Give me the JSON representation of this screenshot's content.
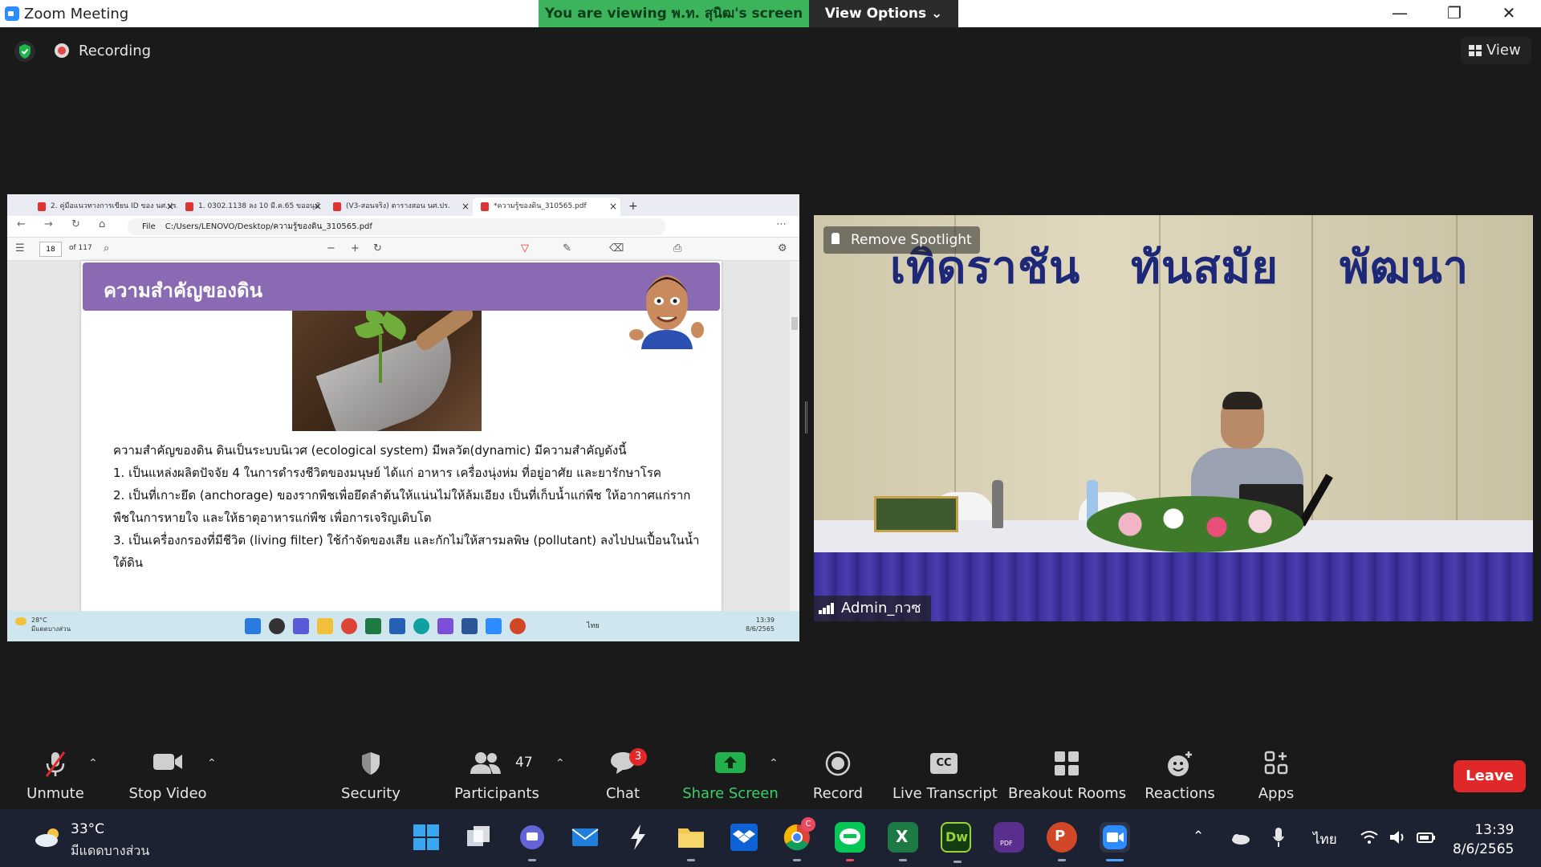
{
  "window": {
    "title": "Zoom Meeting",
    "share_banner": "You are viewing พ.ท. สุนิฒ's screen",
    "view_options": "View Options ⌄",
    "minimize": "—",
    "restore": "❐",
    "close": "✕"
  },
  "topbar": {
    "recording": "Recording",
    "view": "View"
  },
  "shared_screen": {
    "tabs": [
      "2. คู่มือแนวทางการเขียน ID ของ นศ.ปร.",
      "1. 0302.1138 ลง 10 มี.ค.65 ขออนุมั",
      "(V3-สอนจริง) ตารางสอน นศ.ปร.",
      "*ความรู้ของดิน_310565.pdf"
    ],
    "address_label": "File",
    "address_path": "C:/Users/LENOVO/Desktop/ความรู้ของดิน_310565.pdf",
    "page_number": "18",
    "page_total": "of 117",
    "slide_title": "ความสำคัญของดิน",
    "slide_lines": [
      "ความสำคัญของดิน ดินเป็นระบบนิเวศ (ecological system) มีพลวัต(dynamic) มีความสำคัญดังนี้",
      "1. เป็นแหล่งผลิตปัจจัย 4 ในการดำรงชีวิตของมนุษย์ ได้แก่ อาหาร เครื่องนุ่งห่ม ที่อยู่อาศัย และยารักษาโรค",
      "2. เป็นที่เกาะยึด (anchorage) ของรากพืชเพื่อยึดลำต้นให้แน่นไม่ให้ล้มเอียง เป็นที่เก็บน้ำแก่พืช ให้อากาศแก่ราก",
      "พืชในการหายใจ และให้ธาตุอาหารแก่พืช เพื่อการเจริญเติบโต",
      "3. เป็นเครื่องกรองที่มีชีวิต (living filter) ใช้กำจัดของเสีย และกักไม่ให้สารมลพิษ (pollutant) ลงไปปนเปื้อนในน้ำ",
      "ใต้ดิน"
    ],
    "inner_weather_temp": "28°C",
    "inner_weather_cond": "มีแดดบางส่วน",
    "inner_lang": "ไทย",
    "inner_time": "13:39",
    "inner_date": "8/6/2565"
  },
  "video": {
    "banner_words": [
      "เทิดราชัน",
      "ทันสมัย",
      "พัฒนา"
    ],
    "spotlight": "Remove Spotlight",
    "participant_name": "Admin_กวซ"
  },
  "controls": {
    "unmute": "Unmute",
    "stop_video": "Stop Video",
    "security": "Security",
    "participants": "Participants",
    "participants_count": "47",
    "chat": "Chat",
    "chat_badge": "3",
    "share_screen": "Share Screen",
    "record": "Record",
    "live_transcript": "Live Transcript",
    "cc": "CC",
    "breakout_rooms": "Breakout Rooms",
    "reactions": "Reactions",
    "apps": "Apps",
    "leave": "Leave"
  },
  "taskbar": {
    "temp": "33°C",
    "condition": "มีแดดบางส่วน",
    "lang": "ไทย",
    "time": "13:39",
    "date": "8/6/2565",
    "chrome_badge": "C",
    "excel_letter": "X",
    "dw_letter": "Dw",
    "ppt_letter": "P",
    "pdf_label": "PDF"
  },
  "colors": {
    "share_green": "#3bb45c",
    "leave_red": "#e02828",
    "slide_purple": "#8a6bb3",
    "share_screen_green": "#3bcf6b"
  }
}
